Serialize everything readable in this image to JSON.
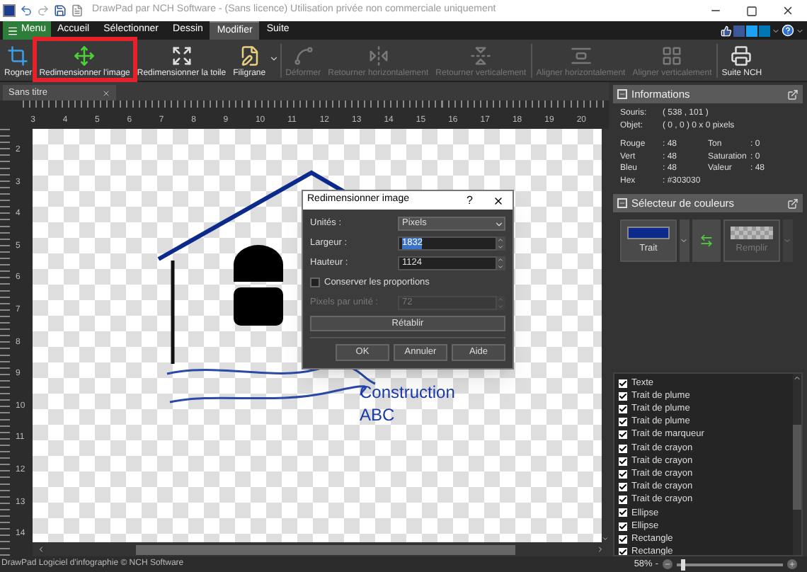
{
  "title_bar": {
    "title": "DrawPad par NCH Software - (Sans licence) Utilisation privée non commerciale uniquement"
  },
  "menu_tabs": [
    {
      "label": "Menu",
      "kind": "menu",
      "selected": false
    },
    {
      "label": "Accueil",
      "kind": "tab",
      "selected": false
    },
    {
      "label": "Sélectionner",
      "kind": "tab",
      "selected": false
    },
    {
      "label": "Dessin",
      "kind": "tab",
      "selected": false
    },
    {
      "label": "Modifier",
      "kind": "tab",
      "selected": true
    },
    {
      "label": "Suite",
      "kind": "tab",
      "selected": false
    }
  ],
  "toolbar": [
    {
      "label": "Rogner",
      "kind": "crop",
      "disabled": false,
      "highlighted": false,
      "dropdown": false
    },
    {
      "label": "Redimensionner l'image",
      "kind": "resize-image",
      "disabled": false,
      "highlighted": true,
      "dropdown": false
    },
    {
      "label": "Redimensionner la toile",
      "kind": "resize-canvas",
      "disabled": false,
      "highlighted": false,
      "dropdown": false
    },
    {
      "label": "Filigrane",
      "kind": "watermark",
      "disabled": false,
      "highlighted": false,
      "dropdown": true
    },
    {
      "label": "Déformer",
      "kind": "distort",
      "disabled": true,
      "highlighted": false,
      "dropdown": false
    },
    {
      "label": "Retourner horizontalement",
      "kind": "flip-h",
      "disabled": true,
      "highlighted": false,
      "dropdown": false
    },
    {
      "label": "Retourner verticalement",
      "kind": "flip-v",
      "disabled": true,
      "highlighted": false,
      "dropdown": false
    },
    {
      "label": "Aligner horizontalement",
      "kind": "align-h",
      "disabled": true,
      "highlighted": false,
      "dropdown": false
    },
    {
      "label": "Aligner verticalement",
      "kind": "align-v",
      "disabled": true,
      "highlighted": false,
      "dropdown": false
    },
    {
      "label": "Suite NCH",
      "kind": "suite",
      "disabled": false,
      "highlighted": false,
      "dropdown": false
    }
  ],
  "document_tab": {
    "label": "Sans titre"
  },
  "rulers": {
    "horizontal": [
      "3",
      "4",
      "5",
      "6",
      "7",
      "8",
      "9",
      "10",
      "11",
      "12",
      "13",
      "14",
      "15",
      "16",
      "17",
      "18",
      "19",
      "20"
    ],
    "vertical": [
      "2",
      "3",
      "4",
      "5",
      "6",
      "7",
      "8",
      "9",
      "10",
      "11",
      "12",
      "13",
      "14"
    ]
  },
  "canvas_texts": [
    "Construction",
    "ABC"
  ],
  "dialog": {
    "title": "Redimensionner image",
    "help": "?",
    "units": {
      "label": "Unités :",
      "value": "Pixels"
    },
    "fields": [
      {
        "label": "Largeur :",
        "value": "1832",
        "highlighted": true,
        "disabled": false
      },
      {
        "label": "Hauteur :",
        "value": "1124",
        "highlighted": false,
        "disabled": false
      }
    ],
    "keep_ratio": {
      "label": "Conserver les proportions",
      "checked": false
    },
    "ppu": {
      "label": "Pixels par unité :",
      "value": "72",
      "disabled": true
    },
    "reset": "Rétablir",
    "buttons": [
      "OK",
      "Annuler",
      "Aide"
    ]
  },
  "info_panel": {
    "title": "Informations",
    "rows": [
      {
        "label": "Souris:",
        "value": "( 538 , 101 )"
      },
      {
        "label": "Objet:",
        "value": "( 0 , 0 ) 0 x 0 pixels"
      }
    ],
    "left_values": [
      {
        "label": "Rouge",
        "value": ": 48"
      },
      {
        "label": "Vert",
        "value": ": 48"
      },
      {
        "label": "Bleu",
        "value": ": 48"
      },
      {
        "label": "Hex",
        "value": ": #303030"
      }
    ],
    "right_values": [
      {
        "label": "Ton",
        "value": ": 0"
      },
      {
        "label": "Saturation",
        "value": ": 0"
      },
      {
        "label": "Valeur",
        "value": ": 48"
      }
    ]
  },
  "color_picker": {
    "title": "Sélecteur de couleurs",
    "stroke": {
      "label": "Trait",
      "color": "#0b2a8c"
    },
    "fill": {
      "label": "Remplir",
      "disabled": true
    }
  },
  "layers": [
    {
      "label": "Texte",
      "checked": true
    },
    {
      "label": "Trait de plume",
      "checked": true
    },
    {
      "label": "Trait de plume",
      "checked": true
    },
    {
      "label": "Trait de plume",
      "checked": true
    },
    {
      "label": "Trait de marqueur",
      "checked": true
    },
    {
      "label": "Trait de crayon",
      "checked": true
    },
    {
      "label": "Trait de crayon",
      "checked": true
    },
    {
      "label": "Trait de crayon",
      "checked": true
    },
    {
      "label": "Trait de crayon",
      "checked": true
    },
    {
      "label": "Trait de crayon",
      "checked": true
    },
    {
      "label": "Ellipse",
      "checked": true
    },
    {
      "label": "Ellipse",
      "checked": true
    },
    {
      "label": "Rectangle",
      "checked": true
    },
    {
      "label": "Rectangle",
      "checked": true
    }
  ],
  "status_bar": {
    "text": "DrawPad Logiciel d'infographie © NCH Software",
    "zoom": "58%",
    "zoom_out": "-",
    "level": 0.04
  }
}
